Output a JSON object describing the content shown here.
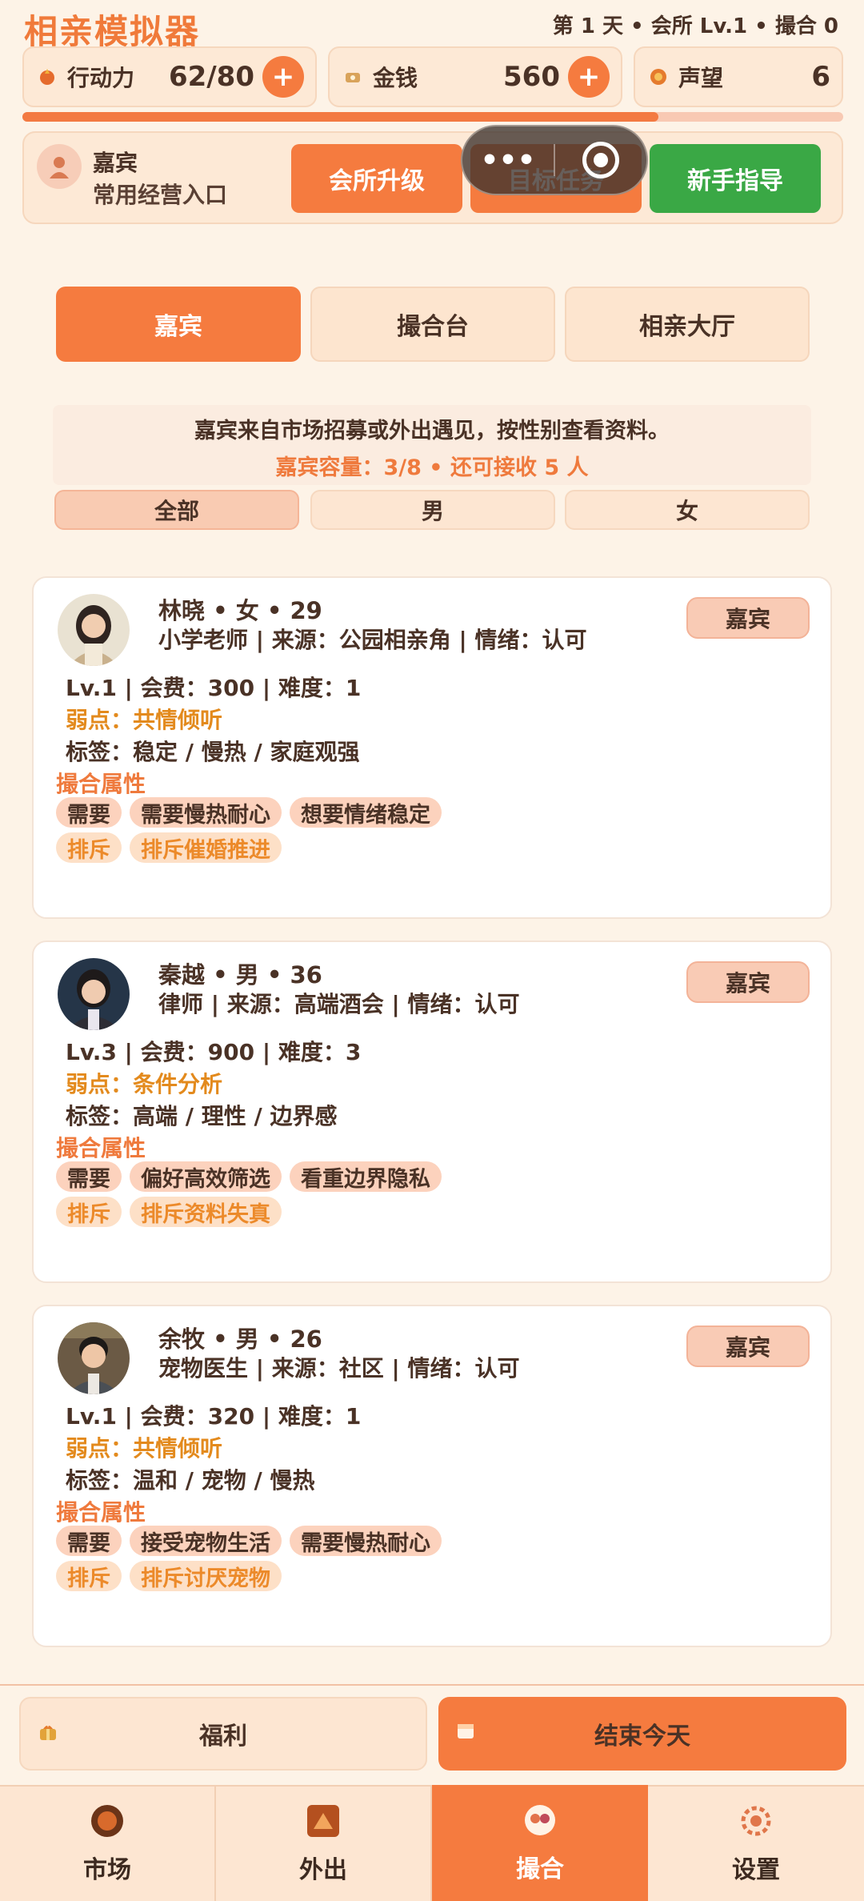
{
  "header": {
    "title": "相亲模拟器",
    "status": "第 1 天 • 会所 Lv.1 • 撮合 0"
  },
  "stats": [
    {
      "label": "行动力",
      "value": "62/80",
      "icon": "energy-icon",
      "has_plus": true
    },
    {
      "label": "金钱",
      "value": "560",
      "icon": "money-icon",
      "has_plus": true
    },
    {
      "label": "声望",
      "value": "6",
      "icon": "reputation-icon",
      "has_plus": false
    }
  ],
  "energy_progress": 0.775,
  "shortcut": {
    "title": "嘉宾",
    "subtitle": "常用经营入口",
    "buttons": [
      "会所升级",
      "目标任务",
      "新手指导"
    ]
  },
  "mini_capsule": {
    "dots": "•••"
  },
  "tabs": [
    "嘉宾",
    "撮合台",
    "相亲大厅"
  ],
  "info": {
    "line1": "嘉宾来自市场招募或外出遇见，按性别查看资料。",
    "line2": "嘉宾容量：3/8 • 还可接收 5 人"
  },
  "filters": [
    "全部",
    "男",
    "女"
  ],
  "guests": [
    {
      "name": "林晓 • 女 • 29",
      "meta": "小学老师 | 来源：公园相亲角 | 情绪：认可",
      "badge": "嘉宾",
      "stats": "Lv.1 | 会费：300 | 难度：1",
      "weakness": "弱点：共情倾听",
      "tags": "标签：稳定 / 慢热 / 家庭观强",
      "match_label": "撮合属性",
      "needs_label": "需要",
      "needs": [
        "需要慢热耐心",
        "想要情绪稳定"
      ],
      "reject_label": "排斥",
      "rejects": [
        "排斥催婚推进"
      ]
    },
    {
      "name": "秦越 • 男 • 36",
      "meta": "律师 | 来源：高端酒会 | 情绪：认可",
      "badge": "嘉宾",
      "stats": "Lv.3 | 会费：900 | 难度：3",
      "weakness": "弱点：条件分析",
      "tags": "标签：高端 / 理性 / 边界感",
      "match_label": "撮合属性",
      "needs_label": "需要",
      "needs": [
        "偏好高效筛选",
        "看重边界隐私"
      ],
      "reject_label": "排斥",
      "rejects": [
        "排斥资料失真"
      ]
    },
    {
      "name": "余牧 • 男 • 26",
      "meta": "宠物医生 | 来源：社区 | 情绪：认可",
      "badge": "嘉宾",
      "stats": "Lv.1 | 会费：320 | 难度：1",
      "weakness": "弱点：共情倾听",
      "tags": "标签：温和 / 宠物 / 慢热",
      "match_label": "撮合属性",
      "needs_label": "需要",
      "needs": [
        "接受宠物生活",
        "需要慢热耐心"
      ],
      "reject_label": "排斥",
      "rejects": [
        "排斥讨厌宠物"
      ]
    }
  ],
  "bottom_actions": {
    "welfare": "福利",
    "end_day": "结束今天"
  },
  "nav": [
    {
      "label": "市场",
      "icon": "market-icon",
      "active": false
    },
    {
      "label": "外出",
      "icon": "outing-icon",
      "active": false
    },
    {
      "label": "撮合",
      "icon": "matchmaking-icon",
      "active": true
    },
    {
      "label": "设置",
      "icon": "settings-icon",
      "active": false
    }
  ],
  "colors": {
    "accent": "#f57b3f",
    "green": "#3aa845",
    "background": "#fdf3e7"
  }
}
